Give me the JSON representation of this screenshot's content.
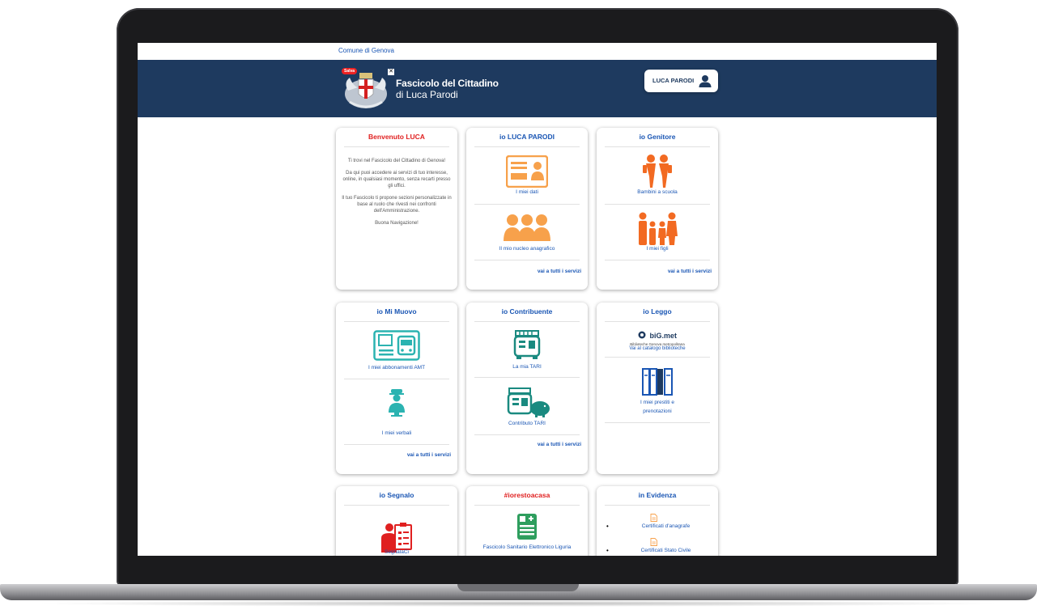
{
  "topbar": {
    "org": "Comune di Genova"
  },
  "header": {
    "salva_label": "Salva",
    "title_line1": "Fascicolo del Cittadino",
    "title_line2": "di Luca Parodi",
    "user_name": "LUCA PARODI"
  },
  "colors": {
    "header_bg": "#1e3a5f",
    "link_blue": "#1a56b4",
    "accent_red": "#e02020",
    "orange": "#f7a14b",
    "orange_red": "#f26a22",
    "teal": "#2bb3b1",
    "green": "#2e9e5e"
  },
  "cards": {
    "welcome": {
      "title": "Benvenuto LUCA",
      "p1": "Ti trovi nel Fascicolo del Cittadino di Genova!",
      "p2": "Da qui puoi accedere ai servizi di tuo interesse, online, in qualsiasi momento, senza recarti presso gli uffici.",
      "p3": "Il tuo Fascicolo ti propone sezioni personalizzate in base al ruolo che rivesti nei confronti dell'Amministrazione.",
      "p4": "Buona Navigazione!"
    },
    "io_luca": {
      "title": "io LUCA PARODI",
      "svc1": "I miei dati",
      "svc2": "Il mio nucleo anagrafico",
      "link": "vai a tutti i servizi"
    },
    "io_genitore": {
      "title": "io Genitore",
      "svc1": "Bambini a scuola",
      "svc2": "I miei figli",
      "link": "vai a tutti i servizi"
    },
    "io_muovo": {
      "title": "io Mi Muovo",
      "svc1": "I miei abbonamenti AMT",
      "svc2": "I miei verbali",
      "link": "vai a tutti i servizi"
    },
    "io_contribuente": {
      "title": "io Contribuente",
      "svc1": "La mia TARI",
      "svc2": "Contributo TARI",
      "link": "vai a tutti i servizi"
    },
    "io_leggo": {
      "title": "io Leggo",
      "brand": "biG.met",
      "brand_sub": "Biblioteche Genova metropolitana",
      "catalog": "Vai al catalogo biblioteche",
      "svc1a": "I miei prestiti e",
      "svc1b": "prenotazioni"
    },
    "io_segnalo": {
      "title": "io Segnalo",
      "svc1": "SegnalaCi"
    },
    "iorestoacasa": {
      "title": "#iorestoacasa",
      "svc1": "Fascicolo Sanitario Elettronico Liguria"
    },
    "in_evidenza": {
      "title": "in Evidenza",
      "items": [
        "Certificati d'anagrafe",
        "Certificati Stato Civile"
      ]
    }
  }
}
